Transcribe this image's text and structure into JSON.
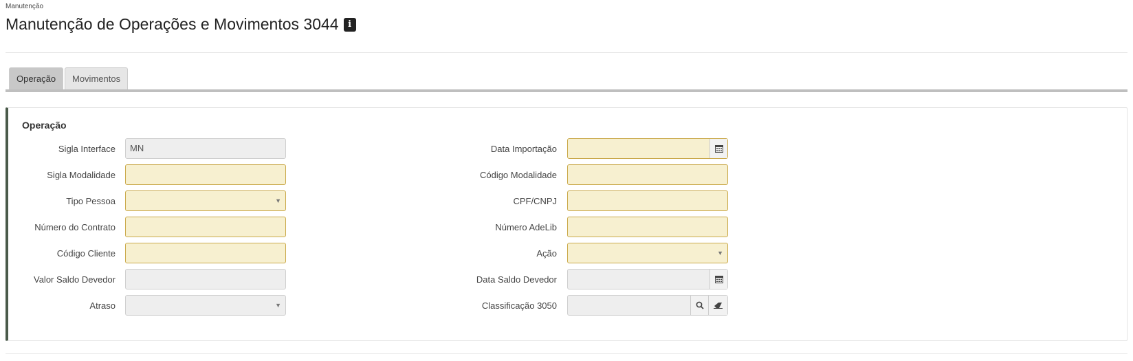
{
  "breadcrumb": "Manutenção",
  "page_title": "Manutenção de Operações e Movimentos 3044",
  "tabs": [
    {
      "label": "Operação",
      "active": true
    },
    {
      "label": "Movimentos",
      "active": false
    }
  ],
  "panel": {
    "title": "Operação",
    "left_fields": [
      {
        "label": "Sigla Interface",
        "value": "MN",
        "type": "text",
        "state": "disabled"
      },
      {
        "label": "Sigla Modalidade",
        "value": "",
        "type": "text",
        "state": "required"
      },
      {
        "label": "Tipo Pessoa",
        "value": "",
        "type": "select",
        "state": "required"
      },
      {
        "label": "Número do Contrato",
        "value": "",
        "type": "text",
        "state": "required"
      },
      {
        "label": "Código Cliente",
        "value": "",
        "type": "text",
        "state": "required"
      },
      {
        "label": "Valor Saldo Devedor",
        "value": "",
        "type": "text",
        "state": "disabled"
      },
      {
        "label": "Atraso",
        "value": "",
        "type": "select",
        "state": "disabled"
      }
    ],
    "right_fields": [
      {
        "label": "Data Importação",
        "value": "",
        "type": "date",
        "state": "required"
      },
      {
        "label": "Código Modalidade",
        "value": "",
        "type": "text",
        "state": "required"
      },
      {
        "label": "CPF/CNPJ",
        "value": "",
        "type": "text",
        "state": "required"
      },
      {
        "label": "Número AdeLib",
        "value": "",
        "type": "text",
        "state": "required"
      },
      {
        "label": "Ação",
        "value": "",
        "type": "select",
        "state": "required"
      },
      {
        "label": "Data Saldo Devedor",
        "value": "",
        "type": "date",
        "state": "disabled"
      },
      {
        "label": "Classificação 3050",
        "value": "",
        "type": "lookup",
        "state": "disabled"
      }
    ]
  },
  "icons": {
    "info": "info-icon",
    "calendar": "calendar-icon",
    "search": "search-icon",
    "eraser": "eraser-icon",
    "caret": "caret-down-icon"
  },
  "colors": {
    "required_bg": "#f7f0d0",
    "required_border": "#caa94a",
    "disabled_bg": "#eeeeee",
    "panel_accent": "#4a5a4a"
  }
}
